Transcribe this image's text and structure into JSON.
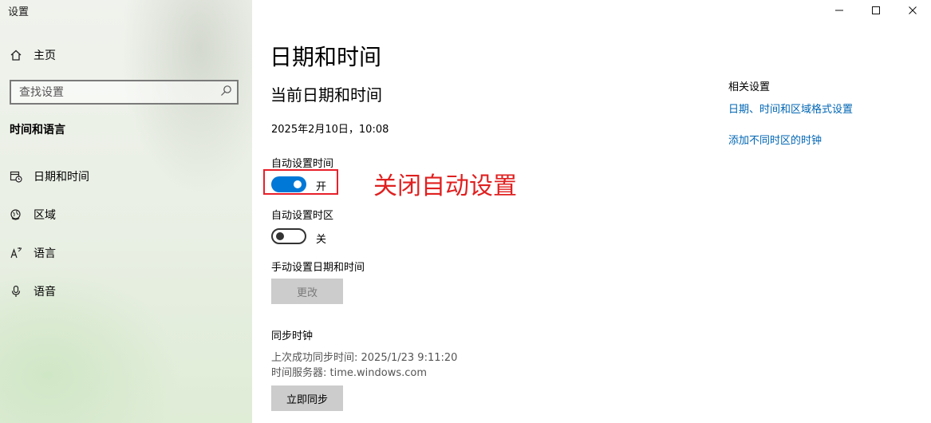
{
  "app": {
    "title": "设置"
  },
  "sidebar": {
    "home": {
      "label": "主页",
      "icon": "home-icon"
    },
    "search": {
      "placeholder": "查找设置",
      "icon": "search-icon"
    },
    "section_title": "时间和语言",
    "items": [
      {
        "label": "日期和时间",
        "icon": "calendar-clock-icon"
      },
      {
        "label": "区域",
        "icon": "globe-icon"
      },
      {
        "label": "语言",
        "icon": "language-icon"
      },
      {
        "label": "语音",
        "icon": "microphone-icon"
      }
    ]
  },
  "main": {
    "title": "日期和时间",
    "subtitle": "当前日期和时间",
    "current_datetime": "2025年2月10日，10:08",
    "auto_time": {
      "label": "自动设置时间",
      "state": "开",
      "on": true
    },
    "auto_timezone": {
      "label": "自动设置时区",
      "state": "关",
      "on": false
    },
    "manual": {
      "label": "手动设置日期和时间",
      "button": "更改"
    },
    "sync": {
      "label": "同步时钟",
      "last_sync": "上次成功同步时间: 2025/1/23 9:11:20",
      "server": "时间服务器: time.windows.com",
      "button": "立即同步"
    },
    "annotation": "关闭自动设置"
  },
  "related": {
    "title": "相关设置",
    "links": [
      "日期、时间和区域格式设置",
      "添加不同时区的时钟"
    ]
  },
  "colors": {
    "accent": "#0078d7",
    "link": "#0066b4",
    "annotation": "#e02020",
    "button": "#cccccc"
  }
}
